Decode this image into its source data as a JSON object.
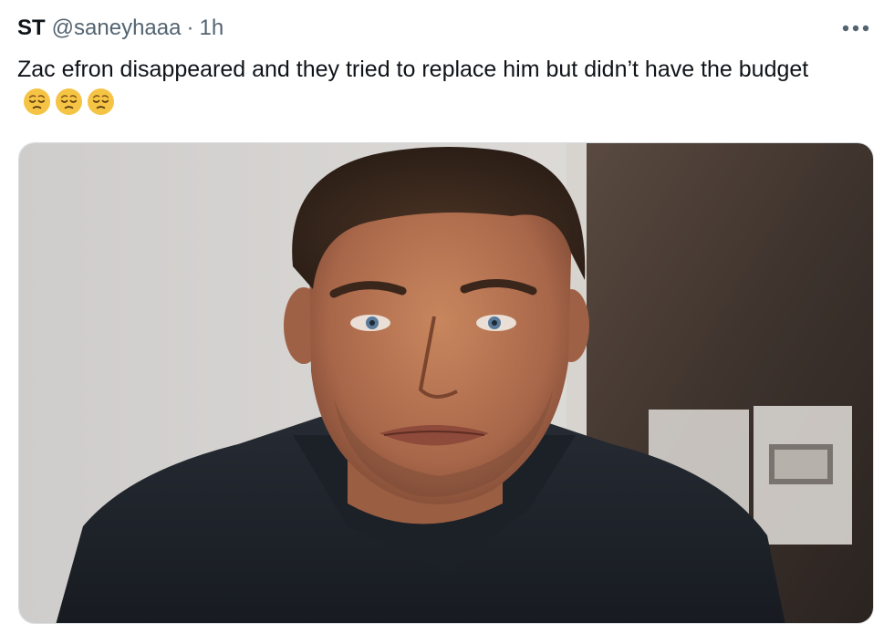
{
  "tweet": {
    "author": {
      "display_name": "ST",
      "handle": "@saneyhaaa"
    },
    "separator": "·",
    "timestamp": "1h",
    "more_icon": "more-horizontal-icon",
    "text": "Zac efron disappeared and they tried to replace him but didn’t have the budget",
    "emojis": [
      "relieved-face-emoji",
      "relieved-face-emoji",
      "relieved-face-emoji"
    ],
    "media": {
      "kind": "photo",
      "subject": "portrait-photo"
    }
  },
  "colors": {
    "text_primary": "#0f1419",
    "text_secondary": "#536471",
    "emoji_yellow": "#f6c445",
    "background": "#ffffff"
  }
}
